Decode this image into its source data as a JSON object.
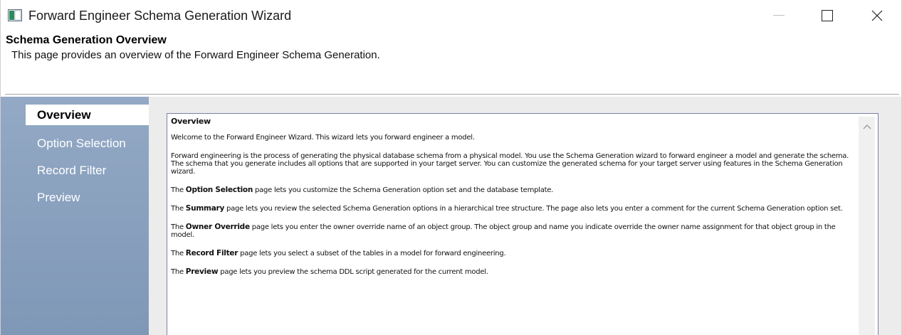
{
  "window": {
    "title": "Forward Engineer Schema Generation Wizard"
  },
  "header": {
    "title": "Schema Generation Overview",
    "subtitle": "This page provides an overview of the Forward Engineer Schema Generation."
  },
  "sidebar": {
    "items": [
      {
        "label": "Overview",
        "active": true
      },
      {
        "label": "Option Selection",
        "active": false
      },
      {
        "label": "Record Filter",
        "active": false
      },
      {
        "label": "Preview",
        "active": false
      }
    ]
  },
  "content": {
    "heading": "Overview",
    "intro": "Welcome to the Forward Engineer Wizard. This wizard lets you forward engineer a model.",
    "description": "Forward engineering is the process of generating the physical database schema from a physical model. You use the Schema Generation wizard to forward engineer a model and generate the schema. The schema that you generate includes all options that are supported in your target server. You can customize the generated schema for your target server using features in the Schema Generation wizard.",
    "pages": [
      {
        "prefix": "The ",
        "name": "Option Selection",
        "text": " page lets you customize the Schema Generation option set and the database template."
      },
      {
        "prefix": "The ",
        "name": "Summary",
        "text": " page lets you review the selected Schema Generation options in a hierarchical tree structure. The page also lets you enter a comment for the current Schema Generation option set."
      },
      {
        "prefix": "The ",
        "name": "Owner Override",
        "text": " page lets you enter the owner override name of an object group. The object group and name you indicate override the owner name assignment for that object group in the model."
      },
      {
        "prefix": "The ",
        "name": "Record Filter",
        "text": " page lets you select a subset of the tables in a model for forward engineering."
      },
      {
        "prefix": "The ",
        "name": "Preview",
        "text": " page lets you preview the schema DDL script generated for the current model."
      }
    ]
  },
  "icons": {
    "app": "wizard-app-icon",
    "minimize": "minimize-icon",
    "maximize": "maximize-icon",
    "close": "close-icon",
    "scroll_up": "chevron-up-icon"
  },
  "colors": {
    "sidebar": "#8aa1bf",
    "panel_border": "#7a7fa8",
    "content_bg": "#ececec"
  }
}
